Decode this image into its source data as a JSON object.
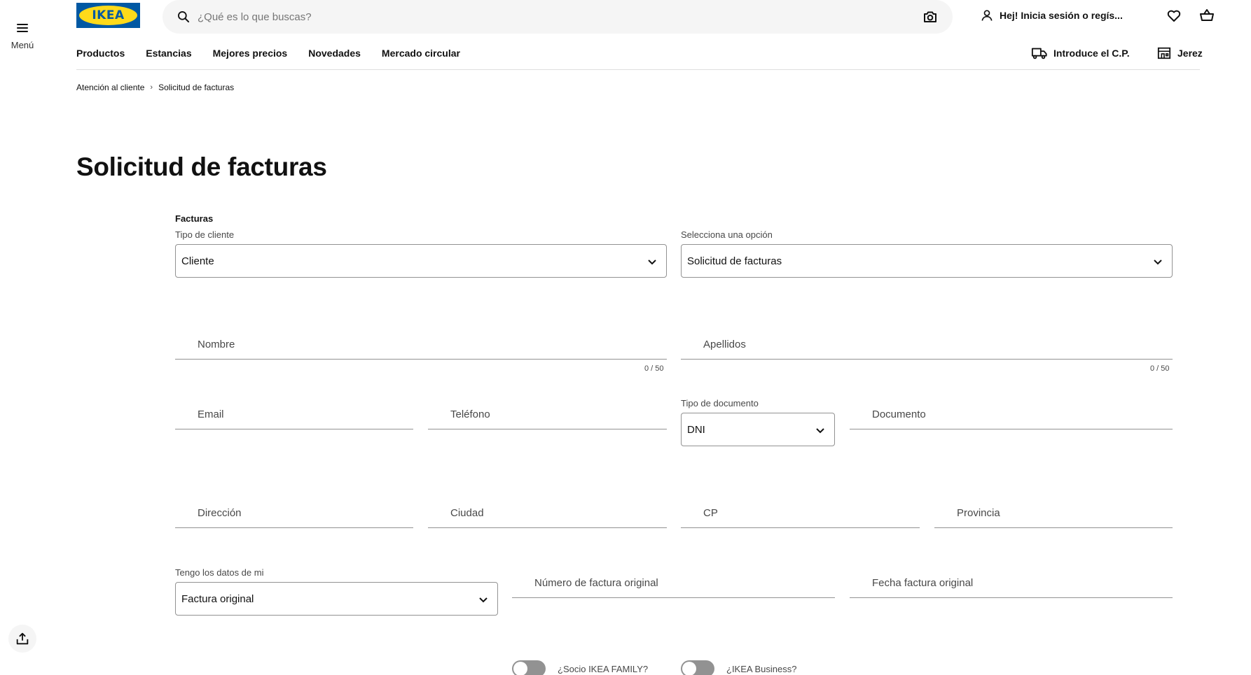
{
  "menu": {
    "label": "Menú"
  },
  "brand": {
    "logo_text": "IKEA",
    "blue": "#0058a3",
    "yellow": "#ffda1a"
  },
  "search": {
    "placeholder": "¿Qué es lo que buscas?",
    "value": ""
  },
  "account": {
    "label": "Hej! Inicia sesión o regís..."
  },
  "header_icons": [
    "user-icon",
    "heart-icon",
    "basket-icon",
    "camera-icon",
    "search-icon"
  ],
  "nav": {
    "items": [
      "Productos",
      "Estancias",
      "Mejores precios",
      "Novedades",
      "Mercado circular"
    ],
    "postal_code": "Introduce el C.P.",
    "store": "Jerez"
  },
  "breadcrumb": {
    "items": [
      "Atención al cliente",
      "Solicitud de facturas"
    ]
  },
  "page": {
    "title": "Solicitud de facturas"
  },
  "form": {
    "section": "Facturas",
    "tipo_cliente": {
      "label": "Tipo de cliente",
      "value": "Cliente"
    },
    "opcion": {
      "label": "Selecciona una opción",
      "value": "Solicitud de facturas"
    },
    "nombre": {
      "placeholder": "Nombre",
      "counter": "0 / 50"
    },
    "apellidos": {
      "placeholder": "Apellidos",
      "counter": "0 / 50"
    },
    "email": {
      "placeholder": "Email"
    },
    "telefono": {
      "placeholder": "Teléfono"
    },
    "tipo_documento": {
      "label": "Tipo de documento",
      "value": "DNI"
    },
    "documento": {
      "placeholder": "Documento"
    },
    "direccion": {
      "placeholder": "Dirección"
    },
    "ciudad": {
      "placeholder": "Ciudad"
    },
    "cp": {
      "placeholder": "CP"
    },
    "provincia": {
      "placeholder": "Provincia"
    },
    "datos": {
      "label": "Tengo los datos de mi",
      "value": "Factura original"
    },
    "numero_factura": {
      "placeholder": "Número de factura original"
    },
    "fecha_factura": {
      "placeholder": "Fecha factura original"
    },
    "toggles": {
      "family": "¿Socio IKEA FAMILY?",
      "business": "¿IKEA Business?"
    }
  }
}
